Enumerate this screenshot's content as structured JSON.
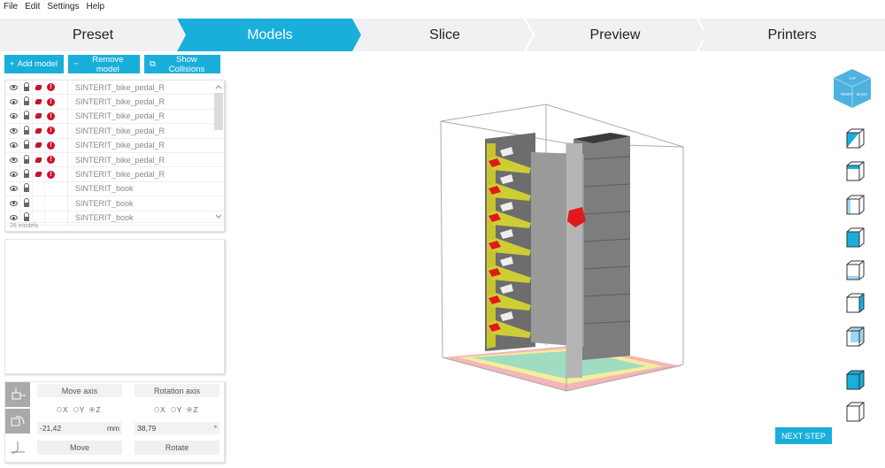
{
  "menu": [
    "File",
    "Edit",
    "Settings",
    "Help"
  ],
  "steps": [
    {
      "label": "Preset",
      "active": false
    },
    {
      "label": "Models",
      "active": true
    },
    {
      "label": "Slice",
      "active": false
    },
    {
      "label": "Preview",
      "active": false
    },
    {
      "label": "Printers",
      "active": false
    }
  ],
  "toolbar": {
    "add_model": "Add model",
    "add_icon": "+",
    "remove_model": "Remove model",
    "remove_icon": "−",
    "show_collisions": "Show Collisions",
    "collisions_icon": "⧉"
  },
  "model_list": {
    "items": [
      {
        "name": "SINTERIT_bike_pedal_R",
        "visible": true,
        "locked": true,
        "collision": true,
        "warning": true
      },
      {
        "name": "SINTERIT_bike_pedal_R",
        "visible": true,
        "locked": true,
        "collision": true,
        "warning": true
      },
      {
        "name": "SINTERIT_bike_pedal_R",
        "visible": true,
        "locked": true,
        "collision": true,
        "warning": true
      },
      {
        "name": "SINTERIT_bike_pedal_R",
        "visible": true,
        "locked": true,
        "collision": true,
        "warning": true
      },
      {
        "name": "SINTERIT_bike_pedal_R",
        "visible": true,
        "locked": true,
        "collision": true,
        "warning": true
      },
      {
        "name": "SINTERIT_bike_pedal_R",
        "visible": true,
        "locked": true,
        "collision": true,
        "warning": true
      },
      {
        "name": "SINTERIT_bike_pedal_R",
        "visible": true,
        "locked": true,
        "collision": true,
        "warning": true
      },
      {
        "name": "SINTERIT_book",
        "visible": true,
        "locked": true,
        "collision": false,
        "warning": false
      },
      {
        "name": "SINTERIT_book",
        "visible": true,
        "locked": true,
        "collision": false,
        "warning": false
      },
      {
        "name": "SINTERIT_book",
        "visible": true,
        "locked": true,
        "collision": false,
        "warning": false
      }
    ],
    "count_label": "28 models",
    "warning_glyph": "!"
  },
  "transform": {
    "move_axis_label": "Move axis",
    "rotation_axis_label": "Rotation axis",
    "move_axes": [
      "X",
      "Y",
      "Z"
    ],
    "move_selected": "Z",
    "rotation_axes": [
      "X",
      "Y",
      "Z"
    ],
    "rotation_selected": "Z",
    "move_value": "-21,42",
    "move_unit": "mm",
    "rotation_value": "38,79",
    "rotation_unit": "°",
    "move_button": "Move",
    "rotate_button": "Rotate"
  },
  "view_cube": {
    "labels": [
      "RIGHT",
      "BACK",
      "TOP"
    ]
  },
  "view_buttons": [
    "iso-view",
    "top-view",
    "left-view",
    "front-view",
    "bottom-view",
    "right-view",
    "back-view",
    "solid-view",
    "wireframe-view"
  ],
  "next_step": "NEXT STEP",
  "colors": {
    "accent": "#1aaedb",
    "warning": "#d0112b",
    "step_bg": "#f1f1f4"
  }
}
